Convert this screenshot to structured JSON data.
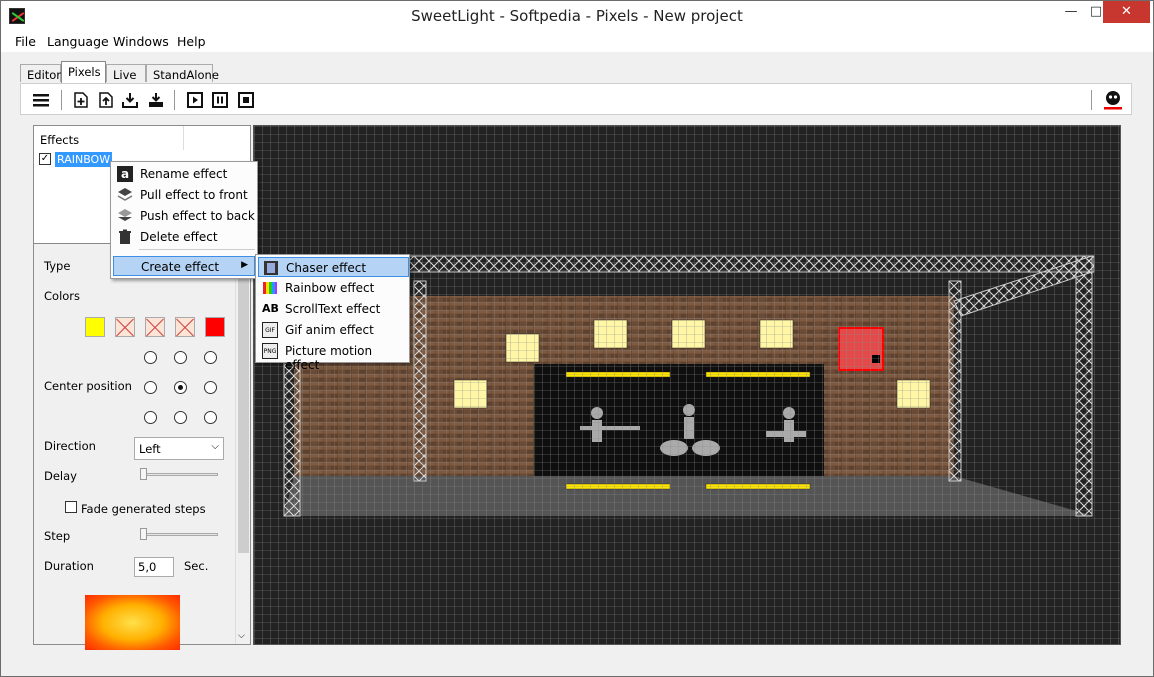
{
  "window": {
    "title": "SweetLight - Softpedia - Pixels - New project",
    "min": "—",
    "max": "□",
    "close": "✕"
  },
  "menubar": [
    "File",
    "Language",
    "Windows",
    "Help"
  ],
  "tabs": [
    "Editor",
    "Pixels",
    "Live",
    "StandAlone"
  ],
  "active_tab": "Pixels",
  "toolbar": {
    "icons": [
      "menu-icon",
      "new-page-icon",
      "upload-icon",
      "import-icon",
      "export-icon",
      "play-icon",
      "pause-icon",
      "stop-icon",
      "record-icon"
    ]
  },
  "effects": {
    "header": "Effects",
    "items": [
      {
        "label": "RAINBOW",
        "checked": true
      }
    ]
  },
  "properties": {
    "type_label": "Type",
    "colors_label": "Colors",
    "center_label": "Center position",
    "direction_label": "Direction",
    "direction_value": "Left",
    "delay_label": "Delay",
    "fade_label": "Fade generated steps",
    "step_label": "Step",
    "duration_label": "Duration",
    "duration_value": "5,0",
    "duration_unit": "Sec.",
    "swatch_colors": [
      "#ffff00",
      "x",
      "x",
      "x",
      "#ff0000"
    ]
  },
  "context_menu": {
    "items": [
      "Rename effect",
      "Pull effect to front",
      "Push effect to back",
      "Delete effect"
    ],
    "create": "Create effect"
  },
  "submenu": {
    "items": [
      "Chaser effect",
      "Rainbow effect",
      "ScrollText effect",
      "Gif anim effect",
      "Picture motion effect"
    ],
    "icon_labels": [
      "",
      "",
      "AB",
      "GIF",
      "PNG"
    ]
  },
  "colors": {
    "selection": "#3399ff",
    "close": "#c7372f",
    "grid": "#8a8a8a"
  }
}
